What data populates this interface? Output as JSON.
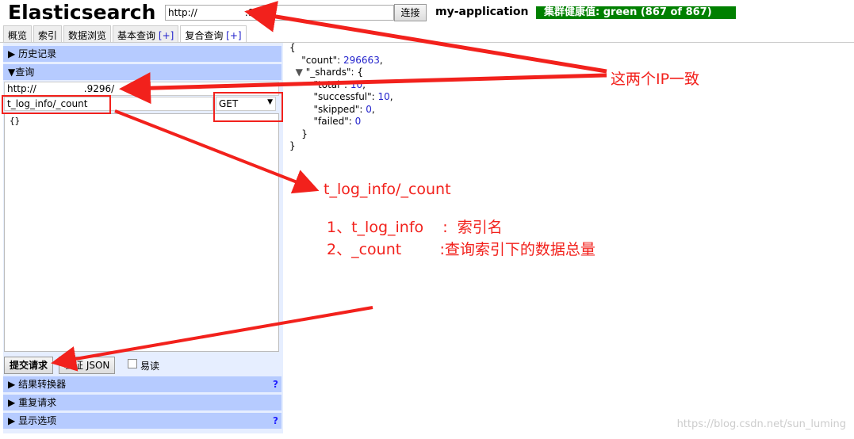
{
  "header": {
    "title": "Elasticsearch",
    "url": "http://     :9296/",
    "connect": "连接",
    "cluster_name": "my-application",
    "health": "集群健康值: green (867 of 867)",
    "health_color": "#008000"
  },
  "tabs": [
    {
      "label": "概览"
    },
    {
      "label": "索引"
    },
    {
      "label": "数据浏览"
    },
    {
      "label": "基本查询",
      "plus": "[+]"
    },
    {
      "label": "复合查询",
      "plus": "[+]",
      "active": true
    }
  ],
  "left": {
    "history": "历史记录",
    "query": "查询",
    "base_url": "http://     .9296/",
    "path": "t_log_info/_count",
    "method": "GET",
    "body": "{}",
    "submit": "提交请求",
    "validate": "验证 JSON",
    "easy_read": "易读",
    "sections": [
      {
        "label": "结果转换器",
        "help": "?"
      },
      {
        "label": "重复请求"
      },
      {
        "label": "显示选项",
        "help": "?"
      }
    ]
  },
  "result": {
    "count": "296663",
    "total": "10",
    "successful": "10",
    "skipped": "0",
    "failed": "0"
  },
  "annotations": {
    "same_ip": "这两个IP一致",
    "path": "t_log_info/_count",
    "line1": "1、t_log_info    :  索引名",
    "line2": "2、_count        :查询索引下的数据总量",
    "color": "#f2211c"
  },
  "watermark": "https://blog.csdn.net/sun_luming"
}
